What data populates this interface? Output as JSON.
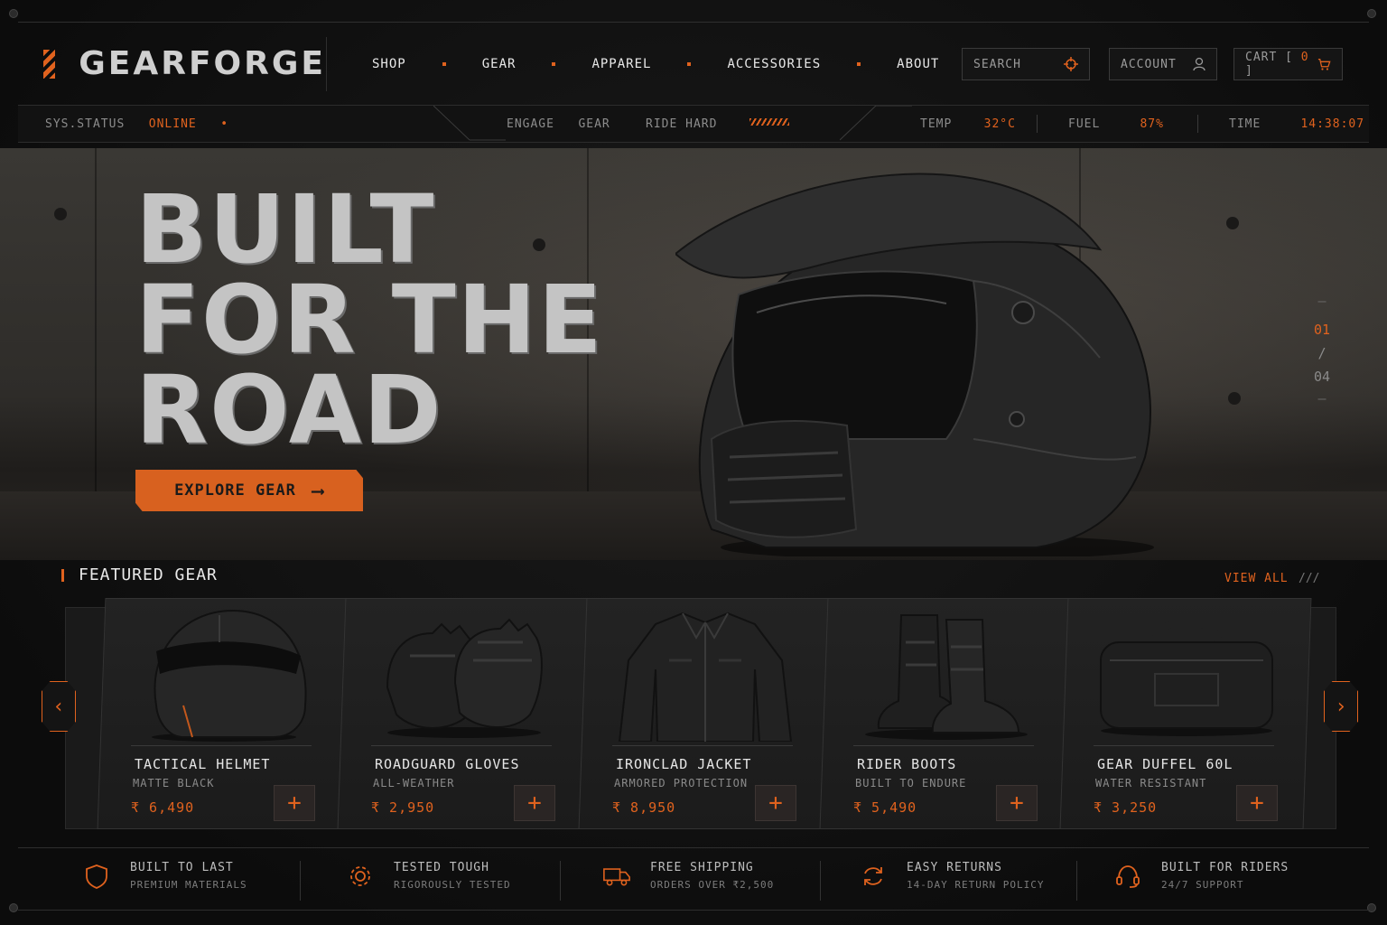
{
  "brand": {
    "name": "GEARFORGE"
  },
  "nav": {
    "items": [
      "SHOP",
      "GEAR",
      "APPAREL",
      "ACCESSORIES",
      "ABOUT"
    ]
  },
  "header": {
    "search_label": "SEARCH",
    "account_label": "ACCOUNT",
    "cart_label": "CART",
    "cart_open": "[",
    "cart_count": "0",
    "cart_close": "]"
  },
  "status": {
    "sys_label": "SYS.STATUS",
    "sys_value": "ONLINE",
    "engage_label": "ENGAGE",
    "engage_value": "GEAR",
    "ride_label": "RIDE HARD",
    "temp_label": "TEMP",
    "temp_value": "32°C",
    "fuel_label": "FUEL",
    "fuel_value": "87%",
    "time_label": "TIME",
    "time_value": "14:38:07"
  },
  "hero": {
    "title_line1": "BUILT",
    "title_line2": "FOR THE",
    "title_line3": "ROAD",
    "cta_label": "EXPLORE GEAR",
    "slide_current": "01",
    "slide_sep": "/",
    "slide_total": "04"
  },
  "featured": {
    "title": "FEATURED GEAR",
    "view_all": "VIEW ALL",
    "view_all_suffix": "///",
    "products": [
      {
        "name": "TACTICAL HELMET",
        "sub": "MATTE BLACK",
        "price": "₹ 6,490",
        "icon": "helmet-icon"
      },
      {
        "name": "ROADGUARD GLOVES",
        "sub": "ALL-WEATHER",
        "price": "₹ 2,950",
        "icon": "gloves-icon"
      },
      {
        "name": "IRONCLAD JACKET",
        "sub": "ARMORED PROTECTION",
        "price": "₹ 8,950",
        "icon": "jacket-icon"
      },
      {
        "name": "RIDER BOOTS",
        "sub": "BUILT TO ENDURE",
        "price": "₹ 5,490",
        "icon": "boots-icon"
      },
      {
        "name": "GEAR DUFFEL 60L",
        "sub": "WATER RESISTANT",
        "price": "₹ 3,250",
        "icon": "duffel-icon"
      }
    ]
  },
  "features": [
    {
      "title": "BUILT TO LAST",
      "sub": "PREMIUM MATERIALS",
      "icon": "shield-icon"
    },
    {
      "title": "TESTED TOUGH",
      "sub": "RIGOROUSLY TESTED",
      "icon": "gear-icon"
    },
    {
      "title": "FREE SHIPPING",
      "sub": "ORDERS OVER ₹2,500",
      "icon": "truck-icon"
    },
    {
      "title": "EASY RETURNS",
      "sub": "14-DAY RETURN POLICY",
      "icon": "returns-icon"
    },
    {
      "title": "BUILT FOR RIDERS",
      "sub": "24/7 SUPPORT",
      "icon": "headset-icon"
    }
  ],
  "colors": {
    "accent": "#e0621e",
    "background": "#111111",
    "card": "#1e1e1e"
  }
}
